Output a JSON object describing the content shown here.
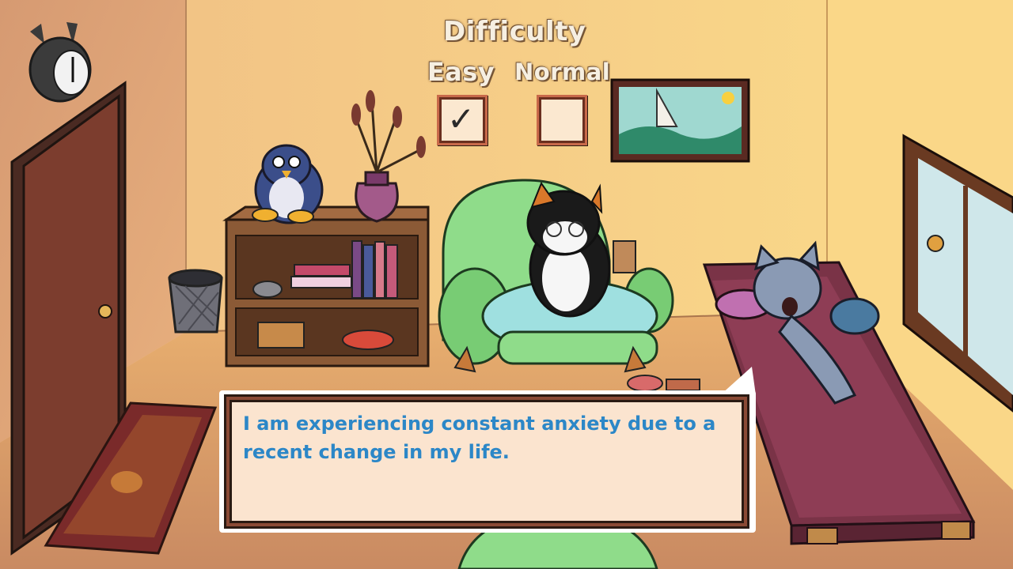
{
  "difficulty": {
    "title": "Difficulty",
    "options": [
      {
        "label": "Easy",
        "checked": true
      },
      {
        "label": "Normal",
        "checked": false
      }
    ],
    "check_glyph": "✓"
  },
  "dialogue": {
    "text": "I am experiencing constant anxiety due to a recent change in my life."
  },
  "colors": {
    "dialogue_text": "#2c87c7",
    "wall": "#f3c98a",
    "couch": "#7a3347",
    "armchair": "#8fdc8a"
  },
  "icons": [
    "clock-icon",
    "door-icon",
    "penguin-plush-icon",
    "vase-icon",
    "painting-icon",
    "therapist-cat-icon",
    "patient-cat-icon",
    "trash-can-icon",
    "rug-icon",
    "window-icon"
  ]
}
